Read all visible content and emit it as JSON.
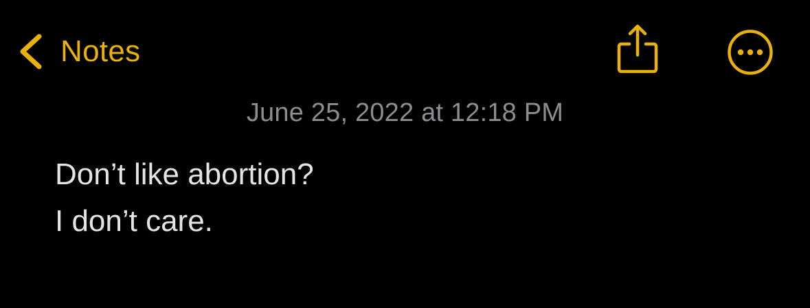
{
  "nav": {
    "back_label": "Notes",
    "back_icon": "chevron-left-icon",
    "share_icon": "share-icon",
    "more_icon": "ellipsis-circle-icon",
    "accent_color": "#e8b10c"
  },
  "note": {
    "date": "June 25, 2022 at 12:18 PM",
    "lines": [
      "Don’t like abortion?",
      "I don’t care."
    ]
  },
  "colors": {
    "background": "#000000",
    "text": "#e4e4e4",
    "date_text": "#8d8d8f"
  }
}
